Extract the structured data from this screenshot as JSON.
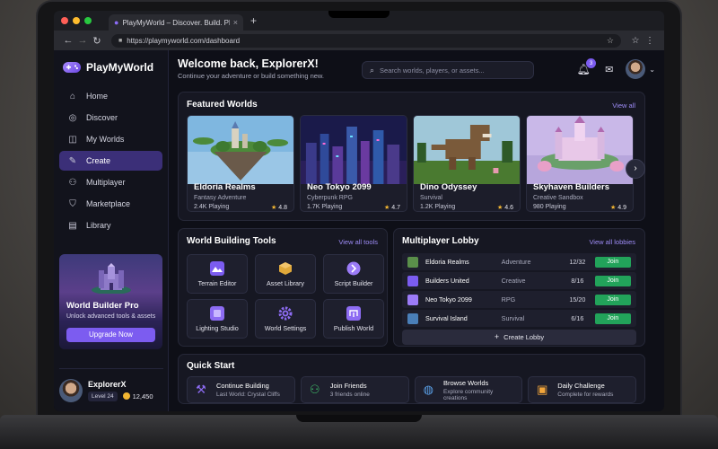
{
  "browser": {
    "tab_title": "PlayMyWorld – Discover. Build. Play.",
    "tab_close": "×",
    "new_tab": "+",
    "url": "https://playmyworld.com/dashboard"
  },
  "brand": {
    "name": "PlayMyWorld"
  },
  "sidebar": {
    "items": [
      {
        "label": "Home",
        "icon": "home-icon"
      },
      {
        "label": "Discover",
        "icon": "compass-icon"
      },
      {
        "label": "My Worlds",
        "icon": "worlds-icon"
      },
      {
        "label": "Create",
        "icon": "create-icon"
      },
      {
        "label": "Multiplayer",
        "icon": "users-icon"
      },
      {
        "label": "Marketplace",
        "icon": "store-icon"
      },
      {
        "label": "Library",
        "icon": "library-icon"
      }
    ],
    "promo": {
      "title": "World Builder Pro",
      "subtitle": "Unlock advanced tools & assets",
      "button": "Upgrade Now"
    },
    "user": {
      "name": "ExplorerX",
      "level": "Level 24",
      "coins": "12,450"
    }
  },
  "header": {
    "welcome": "Welcome back, ExplorerX!",
    "subtitle": "Continue your adventure or build something new.",
    "search_placeholder": "Search worlds, players, or assets...",
    "notifications": "3"
  },
  "featured": {
    "title": "Featured Worlds",
    "view_all": "View all",
    "next": "›",
    "cards": [
      {
        "name": "Eldoria Realms",
        "genre": "Fantasy Adventure",
        "playing": "2.4K Playing",
        "rating": "4.8"
      },
      {
        "name": "Neo Tokyo 2099",
        "genre": "Cyberpunk RPG",
        "playing": "1.7K Playing",
        "rating": "4.7"
      },
      {
        "name": "Dino Odyssey",
        "genre": "Survival",
        "playing": "1.2K Playing",
        "rating": "4.6"
      },
      {
        "name": "Skyhaven Builders",
        "genre": "Creative Sandbox",
        "playing": "980 Playing",
        "rating": "4.9"
      }
    ]
  },
  "tools": {
    "title": "World Building Tools",
    "view_all": "View all tools",
    "items": [
      {
        "label": "Terrain Editor",
        "color": "#7b5cf0"
      },
      {
        "label": "Asset Library",
        "color": "#e0a83a"
      },
      {
        "label": "Script Builder",
        "color": "#9b7bf7"
      },
      {
        "label": "Lighting Studio",
        "color": "#8d6cf3"
      },
      {
        "label": "World Settings",
        "color": "#8d6cf3"
      },
      {
        "label": "Publish World",
        "color": "#8d6cf3"
      }
    ]
  },
  "lobby": {
    "title": "Multiplayer Lobby",
    "view_all": "View all lobbies",
    "rows": [
      {
        "name": "Eldoria Realms",
        "mode": "Adventure",
        "count": "12/32",
        "join": "Join",
        "color": "#5a8f4a"
      },
      {
        "name": "Builders United",
        "mode": "Creative",
        "count": "8/16",
        "join": "Join",
        "color": "#7b5cf0"
      },
      {
        "name": "Neo Tokyo 2099",
        "mode": "RPG",
        "count": "15/20",
        "join": "Join",
        "color": "#9b7bf7"
      },
      {
        "name": "Survival Island",
        "mode": "Survival",
        "count": "6/16",
        "join": "Join",
        "color": "#4a7fb8"
      }
    ],
    "create": "Create Lobby"
  },
  "quick_start": {
    "title": "Quick Start",
    "items": [
      {
        "title": "Continue Building",
        "desc": "Last World: Crystal Cliffs",
        "icon": "hammer-icon",
        "color": "#8d6cf3"
      },
      {
        "title": "Join Friends",
        "desc": "3 friends online",
        "icon": "friends-icon",
        "color": "#3fbf6a"
      },
      {
        "title": "Browse Worlds",
        "desc": "Explore community creations",
        "icon": "globe-icon",
        "color": "#5aa0e8"
      },
      {
        "title": "Daily Challenge",
        "desc": "Complete for rewards",
        "icon": "gift-icon",
        "color": "#f2a53a"
      }
    ]
  }
}
